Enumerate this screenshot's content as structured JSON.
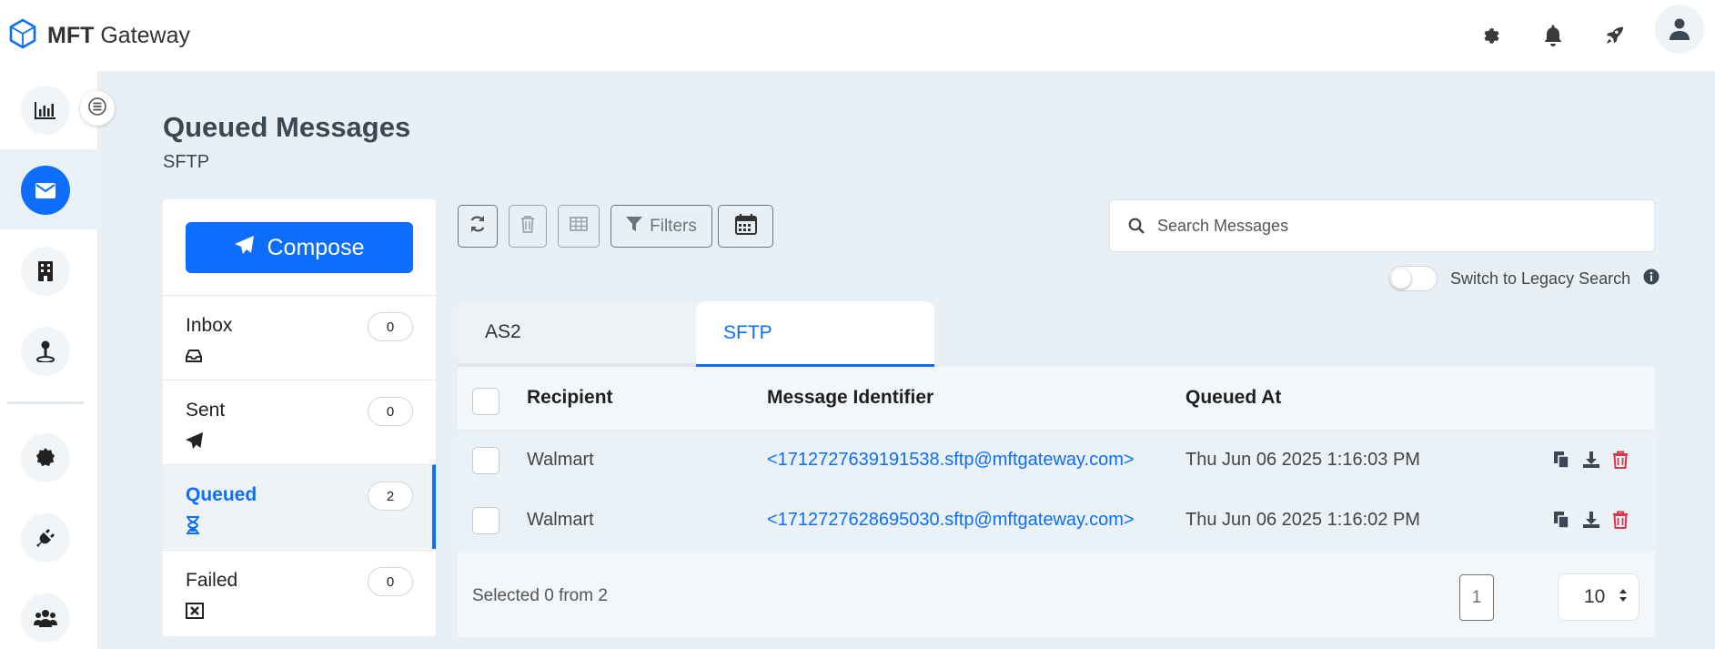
{
  "app": {
    "brand_bold": "MFT",
    "brand_rest": " Gateway"
  },
  "topbar": {
    "icons": [
      "gear-icon",
      "bell-icon",
      "rocket-icon",
      "user-avatar-icon"
    ]
  },
  "rail": {
    "items": [
      "chart-bar-icon",
      "envelope-icon",
      "building-icon",
      "map-pin-icon",
      "certificate-icon",
      "plug-icon",
      "users-icon"
    ],
    "active": "envelope-icon"
  },
  "page": {
    "title": "Queued Messages",
    "subtitle": "SFTP"
  },
  "folders": {
    "compose_label": "Compose",
    "items": [
      {
        "label": "Inbox",
        "count": "0",
        "icon": "inbox-icon"
      },
      {
        "label": "Sent",
        "count": "0",
        "icon": "paper-plane-icon"
      },
      {
        "label": "Queued",
        "count": "2",
        "icon": "hourglass-icon",
        "active": true
      },
      {
        "label": "Failed",
        "count": "0",
        "icon": "x-square-icon"
      }
    ]
  },
  "toolbar": {
    "filters_label": "Filters",
    "search_placeholder": "Search Messages",
    "legacy_label": "Switch to Legacy Search",
    "legacy_on": false
  },
  "tabs": [
    {
      "label": "AS2",
      "active": false
    },
    {
      "label": "SFTP",
      "active": true
    }
  ],
  "table": {
    "headers": [
      "Recipient",
      "Message Identifier",
      "Queued At"
    ],
    "rows": [
      {
        "recipient": "Walmart",
        "identifier": "<1712727639191538.sftp@mftgateway.com>",
        "queued_at": "Thu Jun 06 2025 1:16:03 PM"
      },
      {
        "recipient": "Walmart",
        "identifier": "<1712727628695030.sftp@mftgateway.com>",
        "queued_at": "Thu Jun 06 2025 1:16:02 PM"
      }
    ],
    "selected_text": "Selected 0 from 2",
    "page": "1",
    "per_page": "10"
  },
  "colors": {
    "primary": "#0d6efd",
    "danger": "#dc3545",
    "background": "#e9f0f5"
  }
}
